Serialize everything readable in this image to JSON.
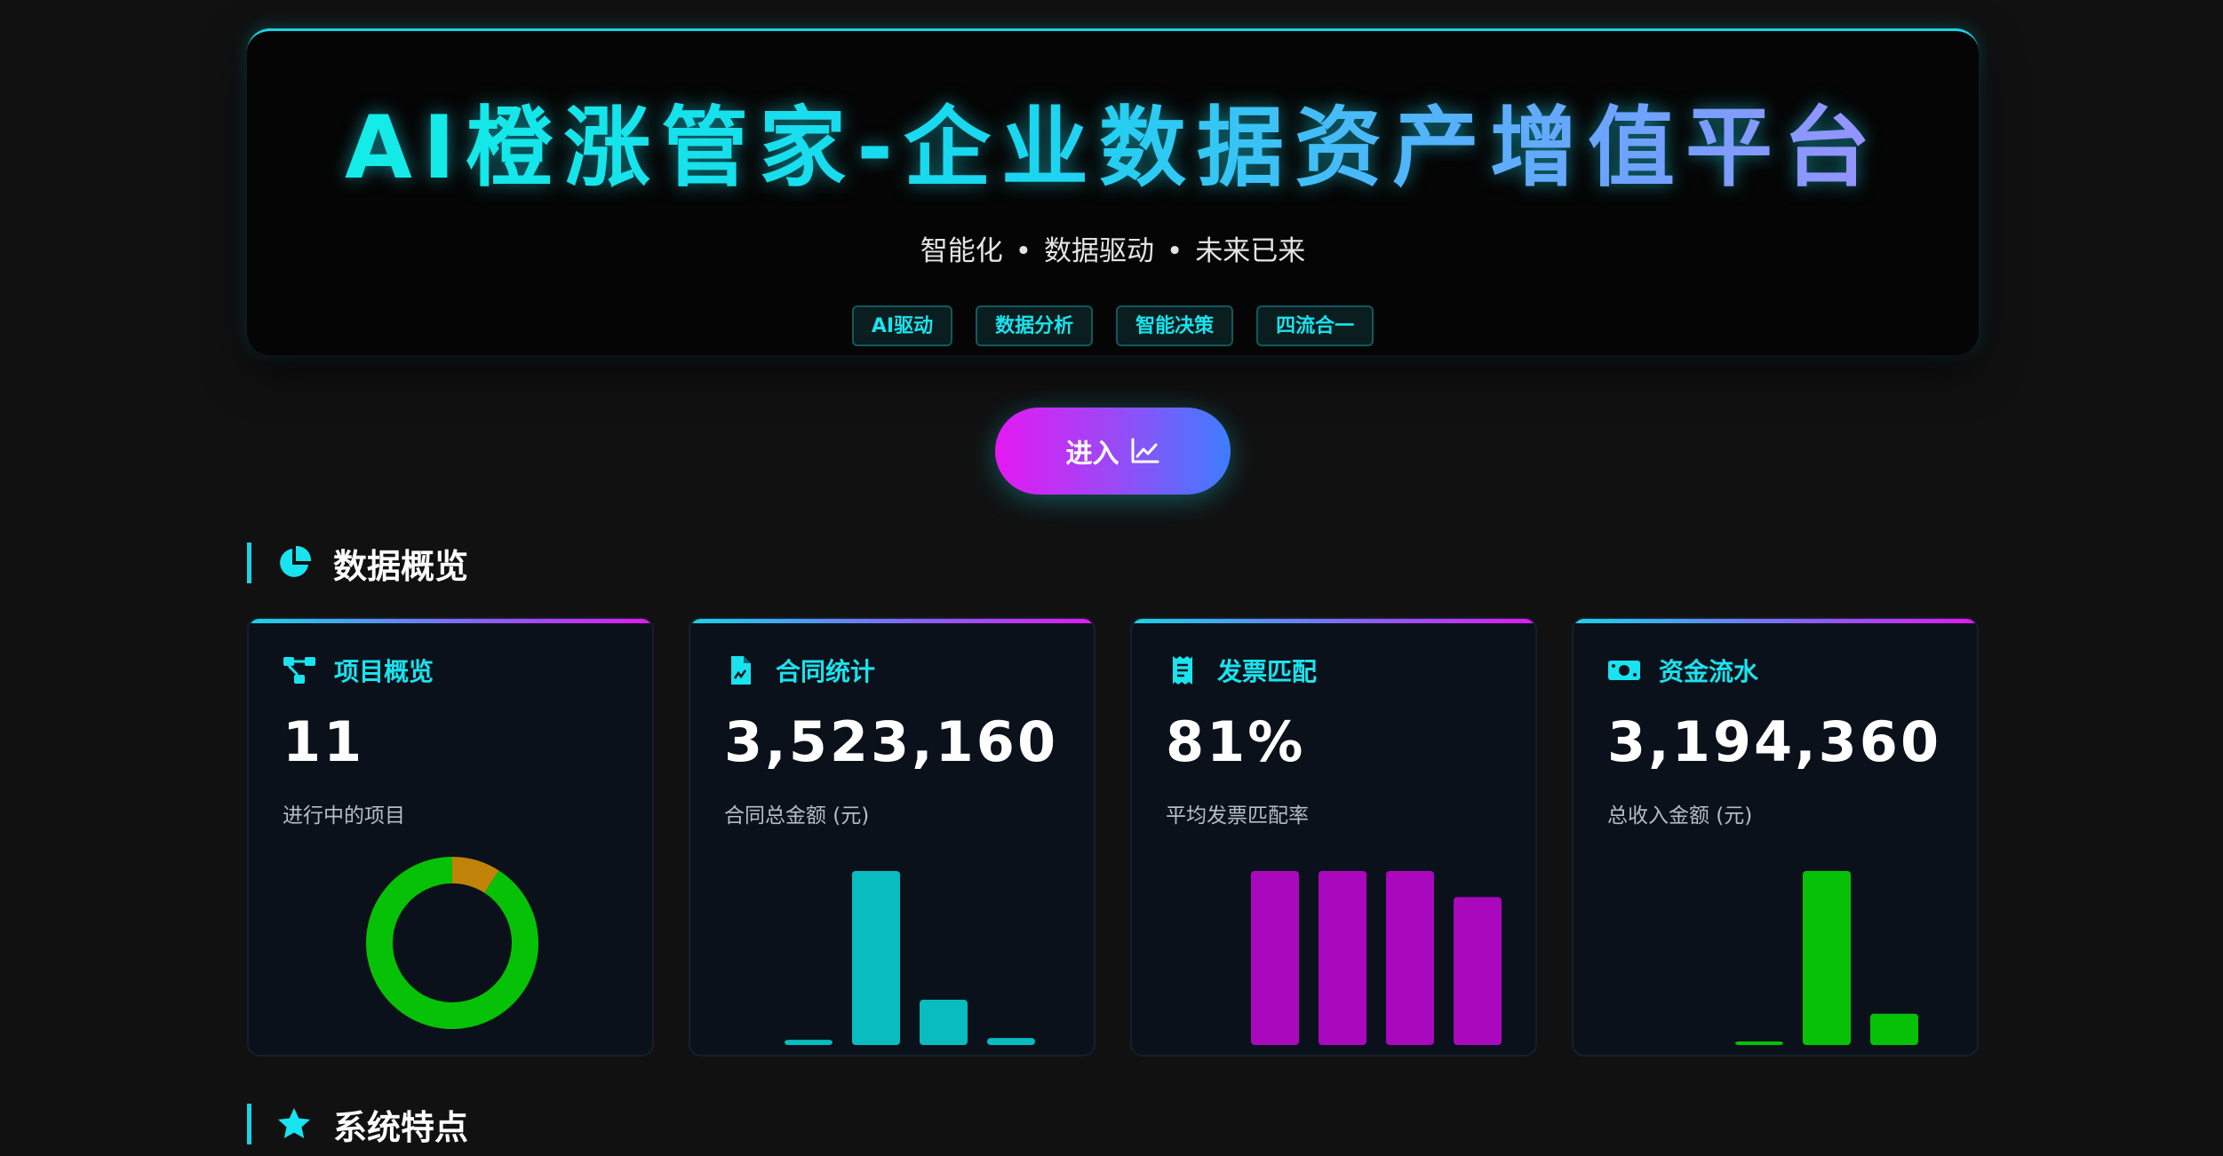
{
  "hero": {
    "title": "AI橙涨管家-企业数据资产增值平台",
    "subtitle_parts": [
      "智能化",
      "数据驱动",
      "未来已来"
    ],
    "separator": "•",
    "tags": [
      "AI驱动",
      "数据分析",
      "智能决策",
      "四流合一"
    ]
  },
  "enter_button": {
    "label": "进入",
    "icon": "line-chart-icon"
  },
  "sections": {
    "overview": {
      "title": "数据概览",
      "icon": "pie-chart-icon"
    },
    "features": {
      "title": "系统特点",
      "icon": "star-icon"
    }
  },
  "cards": [
    {
      "title": "项目概览",
      "icon": "project-diagram-icon",
      "value": "11",
      "desc": "进行中的项目"
    },
    {
      "title": "合同统计",
      "icon": "contract-file-icon",
      "value": "3,523,160",
      "desc": "合同总金额 (元)"
    },
    {
      "title": "发票匹配",
      "icon": "receipt-icon",
      "value": "81%",
      "desc": "平均发票匹配率"
    },
    {
      "title": "资金流水",
      "icon": "money-bill-icon",
      "value": "3,194,360",
      "desc": "总收入金额 (元)"
    }
  ],
  "chart_data": [
    {
      "type": "pie",
      "donut": true,
      "values": [
        10,
        1
      ],
      "colors": [
        "#06c106",
        "#c0830a"
      ]
    },
    {
      "type": "bar",
      "values": [
        3,
        100,
        26,
        4
      ],
      "color": "#08bcbf"
    },
    {
      "type": "bar",
      "values": [
        100,
        100,
        100,
        85
      ],
      "color": "#a908bd"
    },
    {
      "type": "bar",
      "values": [
        2,
        100,
        18
      ],
      "color": "#06c106"
    }
  ],
  "colors": {
    "accent": "#19d3e6",
    "background": "#111111",
    "card_bg": "#0a111b"
  }
}
